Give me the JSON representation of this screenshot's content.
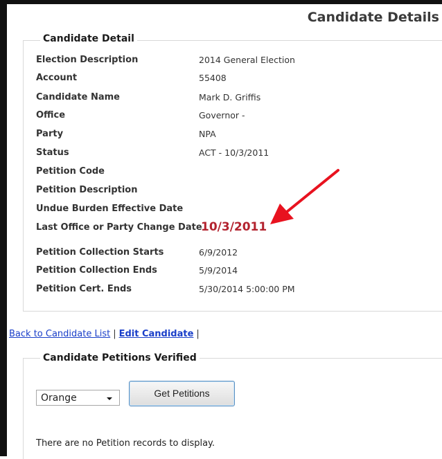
{
  "header": {
    "title": "Candidate Details"
  },
  "candidate_detail": {
    "legend": "Candidate Detail",
    "rows": [
      {
        "label": "Election Description",
        "value": "2014 General Election"
      },
      {
        "label": "Account",
        "value": "55408"
      },
      {
        "label": "Candidate Name",
        "value": "Mark D. Griffis"
      },
      {
        "label": "Office",
        "value": "Governor -"
      },
      {
        "label": "Party",
        "value": "NPA"
      },
      {
        "label": "Status",
        "value": "ACT - 10/3/2011"
      },
      {
        "label": "Petition Code",
        "value": ""
      },
      {
        "label": "Petition Description",
        "value": ""
      },
      {
        "label": "Undue Burden Effective Date",
        "value": ""
      },
      {
        "label": "Last Office or Party Change Date",
        "value": "10/3/2011"
      },
      {
        "label": "Petition Collection Starts",
        "value": "6/9/2012"
      },
      {
        "label": "Petition Collection Ends",
        "value": "5/9/2014"
      },
      {
        "label": "Petition Cert. Ends",
        "value": "5/30/2014 5:00:00 PM"
      }
    ]
  },
  "links": {
    "back": "Back to Candidate List",
    "separator": "|",
    "edit": "Edit Candidate",
    "trailing": "|"
  },
  "petitions": {
    "legend": "Candidate Petitions Verified",
    "county_select": {
      "selected": "Orange"
    },
    "get_button": "Get Petitions",
    "empty_message": "There are no Petition records to display."
  },
  "colors": {
    "highlight": "#b3232f",
    "annotation_arrow": "#e8121f",
    "link": "#1a3fc9"
  }
}
